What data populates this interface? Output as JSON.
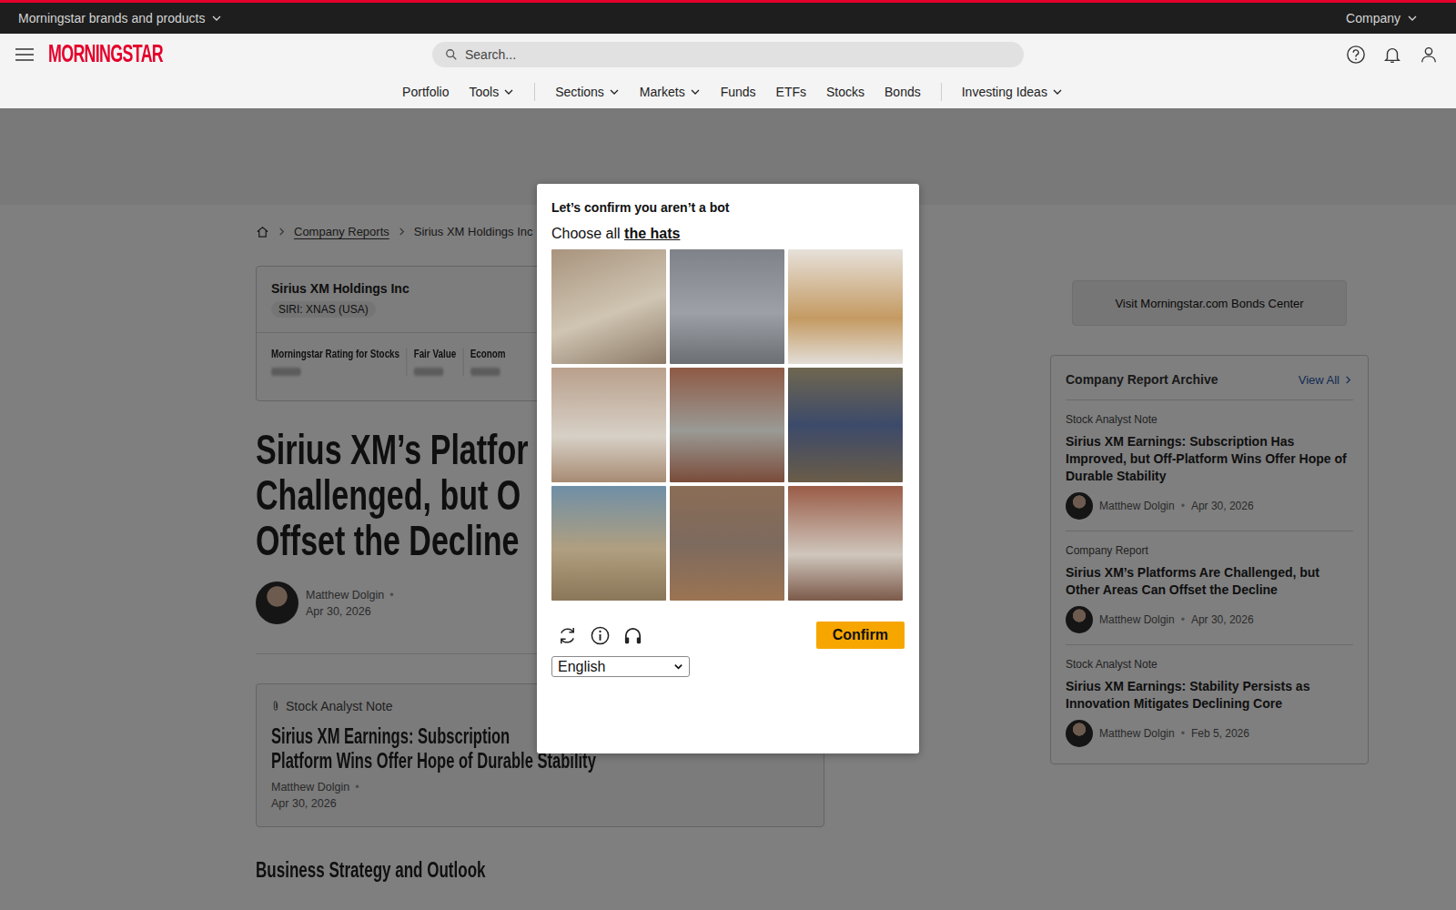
{
  "top_bar": [
    {
      "label": "Morningstar brands and products",
      "dropdown": true
    },
    {
      "label": "Company",
      "dropdown": true
    }
  ],
  "header": {
    "logo": "MORNINGSTAR",
    "search_placeholder": "Search..."
  },
  "nav": [
    {
      "kind": "link",
      "label": "Portfolio",
      "dropdown": false
    },
    {
      "kind": "link",
      "label": "Tools",
      "dropdown": true
    },
    {
      "kind": "divider"
    },
    {
      "kind": "link",
      "label": "Sections",
      "dropdown": true
    },
    {
      "kind": "link",
      "label": "Markets",
      "dropdown": true
    },
    {
      "kind": "link",
      "label": "Funds",
      "dropdown": false
    },
    {
      "kind": "link",
      "label": "ETFs",
      "dropdown": false
    },
    {
      "kind": "link",
      "label": "Stocks",
      "dropdown": false
    },
    {
      "kind": "link",
      "label": "Bonds",
      "dropdown": false
    },
    {
      "kind": "divider"
    },
    {
      "kind": "link",
      "label": "Investing Ideas",
      "dropdown": true
    }
  ],
  "breadcrumb": [
    {
      "label": "Company Reports"
    },
    {
      "label": "Sirius XM Holdings Inc"
    }
  ],
  "quote_card": {
    "name": "Sirius XM Holdings Inc",
    "ticker": "SIRI: XNAS (USA)",
    "metrics": [
      "Morningstar Rating for Stocks",
      "Fair Value",
      "Econom"
    ]
  },
  "byline_separator": "•",
  "article": {
    "title_lines": [
      "Sirius XM’s Platfor",
      "Challenged, but O",
      "Offset the Decline"
    ],
    "author": "Matthew Dolgin",
    "date": "Apr 30, 2026"
  },
  "analyst_note": {
    "type": "Stock Analyst Note",
    "title_lines": [
      "Sirius XM Earnings: Subscription",
      "Platform Wins Offer Hope of Durable Stability"
    ],
    "author": "Matthew Dolgin",
    "date": "Apr 30, 2026"
  },
  "section_heading": "Business Strategy and Outlook",
  "sidebar": {
    "bonds_button": "Visit Morningstar.com Bonds Center",
    "archive": {
      "title": "Company Report Archive",
      "view_all": "View All",
      "items": [
        {
          "type": "Stock Analyst Note",
          "title": "Sirius XM Earnings: Subscription Has Improved, but Off-Platform Wins Offer Hope of Durable Stability",
          "author": "Matthew Dolgin",
          "date": "Apr 30, 2026"
        },
        {
          "type": "Company Report",
          "title": "Sirius XM’s Platforms Are Challenged, but Other Areas Can Offset the Decline",
          "author": "Matthew Dolgin",
          "date": "Apr 30, 2026"
        },
        {
          "type": "Stock Analyst Note",
          "title": "Sirius XM Earnings: Stability Persists as Innovation Mitigates Declining Core",
          "author": "Matthew Dolgin",
          "date": "Feb 5, 2026"
        }
      ]
    }
  },
  "captcha": {
    "title": "Let’s confirm you aren’t a bot",
    "prompt": "Choose all",
    "target": "the hats",
    "tiles": [
      {
        "selected": false
      },
      {
        "selected": false
      },
      {
        "selected": false
      },
      {
        "selected": false
      },
      {
        "selected": false
      },
      {
        "selected": false
      },
      {
        "selected": false
      },
      {
        "selected": false
      },
      {
        "selected": false
      }
    ],
    "confirm": "Confirm",
    "language": "English"
  }
}
